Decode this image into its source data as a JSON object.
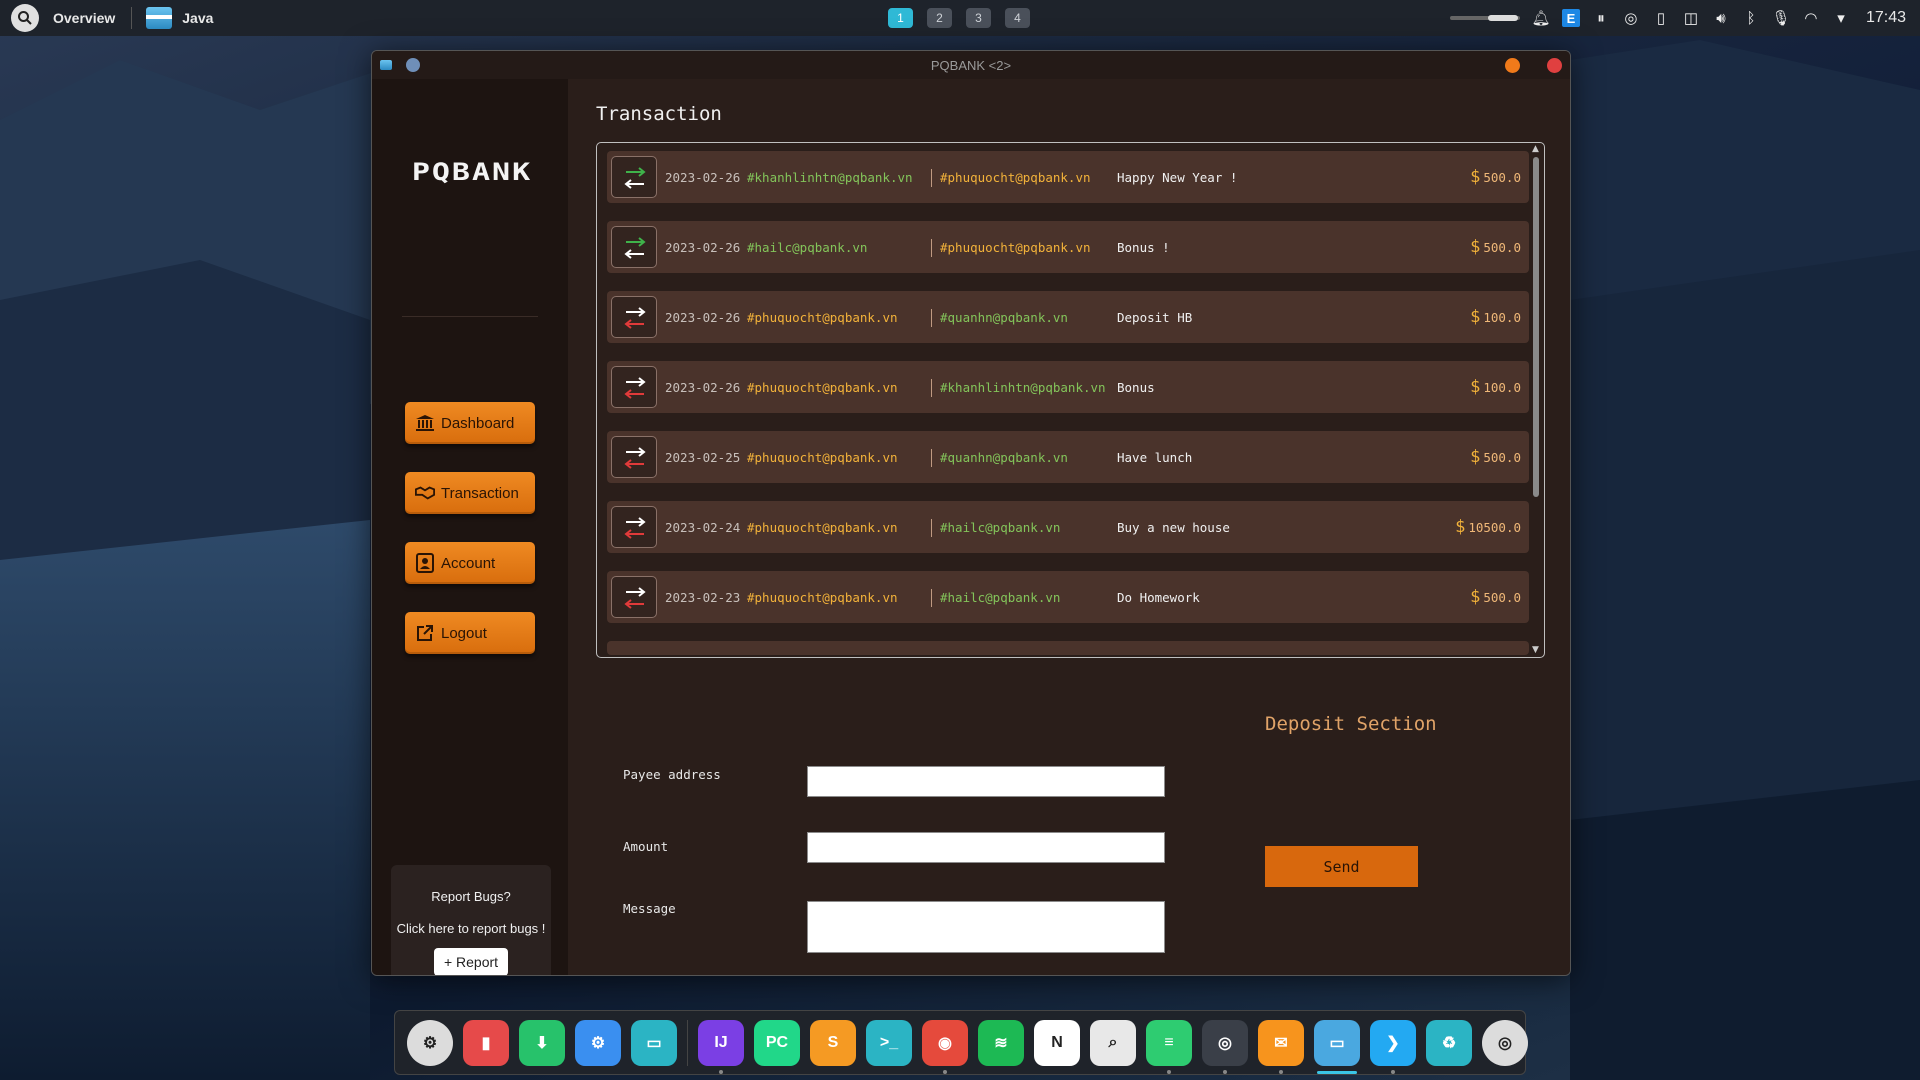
{
  "top_panel": {
    "overview_label": "Overview",
    "app_label": "Java",
    "workspaces": [
      "1",
      "2",
      "3",
      "4"
    ],
    "active_workspace": "1",
    "clock": "17:43",
    "tray_icons": [
      "notification-bell-icon",
      "e-app-icon",
      "pause-icon",
      "obs-icon",
      "clipboard-icon",
      "screen-cast-icon",
      "volume-icon",
      "bluetooth-icon",
      "microphone-icon",
      "wifi-icon",
      "dropdown-icon"
    ]
  },
  "window": {
    "title": "PQBANK <2>"
  },
  "sidebar": {
    "logo": "PQBANK",
    "nav": [
      {
        "label": "Dashboard",
        "icon": "bank-icon"
      },
      {
        "label": "Transaction",
        "icon": "handshake-icon"
      },
      {
        "label": "Account",
        "icon": "account-icon"
      },
      {
        "label": "Logout",
        "icon": "external-link-icon"
      }
    ],
    "report": {
      "title": "Report Bugs?",
      "subtitle": "Click here to report bugs !",
      "button": "+ Report"
    }
  },
  "main": {
    "title": "Transaction",
    "transactions": [
      {
        "direction": "in",
        "date": "2023-02-26",
        "from": "#khanhlinhtn@pqbank.vn",
        "to": "#phuquocht@pqbank.vn",
        "message": "Happy New Year !",
        "currency": "$",
        "amount": "500.0"
      },
      {
        "direction": "in",
        "date": "2023-02-26",
        "from": "#hailc@pqbank.vn",
        "to": "#phuquocht@pqbank.vn",
        "message": "Bonus !",
        "currency": "$",
        "amount": "500.0"
      },
      {
        "direction": "out",
        "date": "2023-02-26",
        "from": "#phuquocht@pqbank.vn",
        "to": "#quanhn@pqbank.vn",
        "message": "Deposit HB",
        "currency": "$",
        "amount": "100.0"
      },
      {
        "direction": "out",
        "date": "2023-02-26",
        "from": "#phuquocht@pqbank.vn",
        "to": "#khanhlinhtn@pqbank.vn",
        "message": "Bonus",
        "currency": "$",
        "amount": "100.0"
      },
      {
        "direction": "out",
        "date": "2023-02-25",
        "from": "#phuquocht@pqbank.vn",
        "to": "#quanhn@pqbank.vn",
        "message": "Have lunch",
        "currency": "$",
        "amount": "500.0"
      },
      {
        "direction": "out",
        "date": "2023-02-24",
        "from": "#phuquocht@pqbank.vn",
        "to": "#hailc@pqbank.vn",
        "message": "Buy a new house",
        "currency": "$",
        "amount": "10500.0"
      },
      {
        "direction": "out",
        "date": "2023-02-23",
        "from": "#phuquocht@pqbank.vn",
        "to": "#hailc@pqbank.vn",
        "message": "Do Homework",
        "currency": "$",
        "amount": "500.0"
      }
    ],
    "form": {
      "payee_label": "Payee address",
      "payee_value": "",
      "amount_label": "Amount",
      "amount_value": "",
      "message_label": "Message",
      "message_value": "",
      "section_title": "Deposit Section",
      "send_label": "Send"
    }
  },
  "dock": {
    "items": [
      {
        "name": "ubuntu-settings-icon",
        "color": "#dcdcdc",
        "glyph": "⚙"
      },
      {
        "name": "audio-mixer-icon",
        "color": "#e64a4a",
        "glyph": "▮"
      },
      {
        "name": "download-manager-icon",
        "color": "#27c26b",
        "glyph": "⬇"
      },
      {
        "name": "system-settings-icon",
        "color": "#3a8ff0",
        "glyph": "⚙"
      },
      {
        "name": "files-icon",
        "color": "#2bb4c4",
        "glyph": "▭"
      },
      {
        "name": "intellij-icon",
        "color": "#7b3fe4",
        "glyph": "IJ"
      },
      {
        "name": "pycharm-icon",
        "color": "#21d789",
        "glyph": "PC"
      },
      {
        "name": "sublime-text-icon",
        "color": "#f59a23",
        "glyph": "S"
      },
      {
        "name": "terminal-icon",
        "color": "#2bb4c4",
        "glyph": ">_"
      },
      {
        "name": "chrome-icon",
        "color": "#e54a3c",
        "glyph": "◉"
      },
      {
        "name": "spotify-icon",
        "color": "#1db954",
        "glyph": "≋"
      },
      {
        "name": "notion-icon",
        "color": "#ffffff",
        "glyph": "N"
      },
      {
        "name": "search-tool-icon",
        "color": "#e8e8e8",
        "glyph": "⌕"
      },
      {
        "name": "database-icon",
        "color": "#2ecc71",
        "glyph": "≡"
      },
      {
        "name": "obs-icon",
        "color": "#3a3f48",
        "glyph": "◎"
      },
      {
        "name": "postman-icon",
        "color": "#f7941d",
        "glyph": "✉"
      },
      {
        "name": "java-app-icon",
        "color": "#4aa8e0",
        "glyph": "▭"
      },
      {
        "name": "vscode-icon",
        "color": "#23a9f2",
        "glyph": "❯"
      },
      {
        "name": "trash-icon",
        "color": "#2bb4c4",
        "glyph": "♻"
      },
      {
        "name": "disk-icon",
        "color": "#dcdcdc",
        "glyph": "◎"
      }
    ]
  }
}
